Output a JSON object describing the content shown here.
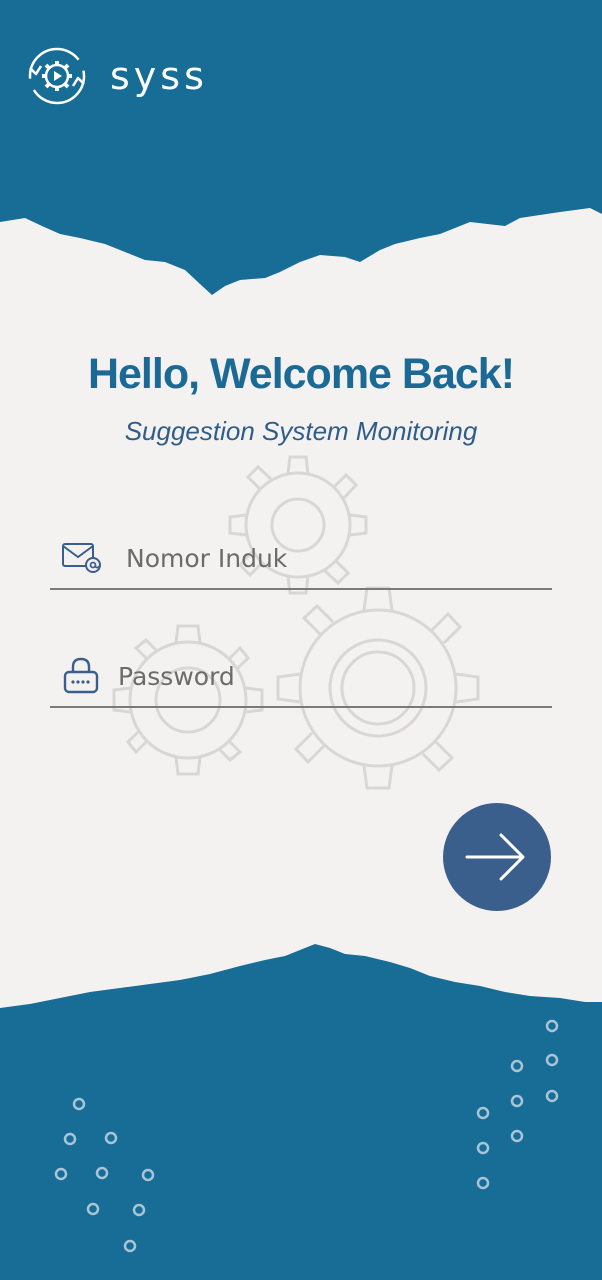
{
  "app": {
    "logo_text": "syss"
  },
  "welcome": {
    "title": "Hello, Welcome Back!",
    "subtitle": "Suggestion System Monitoring"
  },
  "form": {
    "nomor_induk": {
      "placeholder": "Nomor Induk",
      "value": "",
      "icon": "email-icon"
    },
    "password": {
      "placeholder": "Password",
      "value": "",
      "icon": "lock-icon"
    },
    "submit": {
      "icon": "arrow-right-icon"
    }
  },
  "colors": {
    "brand_blue": "#176d96",
    "title_blue": "#1b6a96",
    "button_blue": "#3b5f8c",
    "background": "#f4f1f1"
  }
}
